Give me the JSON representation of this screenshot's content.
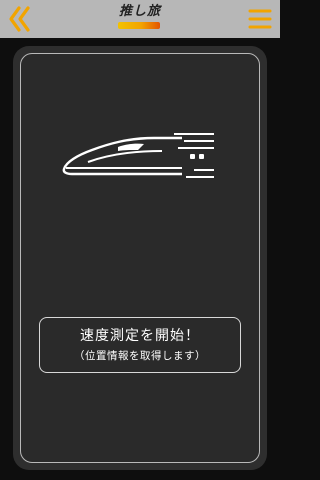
{
  "header": {
    "logo_text": "推し旅",
    "back_icon": "double-chevron-left-icon",
    "menu_icon": "hamburger-menu-icon",
    "accent_color": "#f2a400"
  },
  "main": {
    "illustration_icon": "bullet-train-icon",
    "start_button": {
      "title": "速度測定を開始！",
      "subtitle": "（位置情報を取得します）"
    }
  }
}
